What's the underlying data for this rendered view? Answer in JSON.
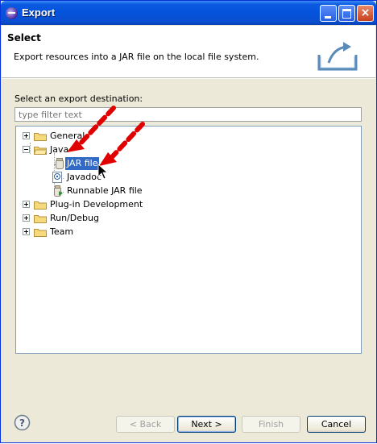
{
  "window": {
    "title": "Export"
  },
  "header": {
    "title": "Select",
    "description": "Export resources into a JAR file on the local file system."
  },
  "destination": {
    "label": "Select an export destination:",
    "filter_placeholder": "type filter text"
  },
  "tree": {
    "general": "General",
    "java": "Java",
    "jar_file": "JAR file",
    "javadoc": "Javadoc",
    "runnable_jar": "Runnable JAR file",
    "plugin": "Plug-in Development",
    "rundebug": "Run/Debug",
    "team": "Team"
  },
  "buttons": {
    "back": "< Back",
    "next": "Next >",
    "finish": "Finish",
    "cancel": "Cancel"
  },
  "colors": {
    "title_bar": "#0553dc",
    "selection": "#316ac5",
    "annotation_arrow": "#e00000"
  }
}
